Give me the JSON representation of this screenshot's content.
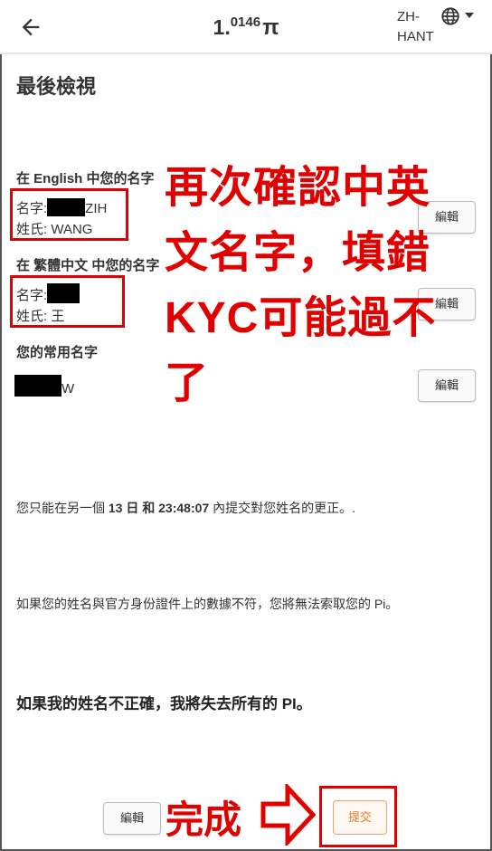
{
  "header": {
    "balance_int": "1.",
    "balance_frac": "0146",
    "currency_symbol": "π",
    "language": "ZH-HANT"
  },
  "page_title": "最後檢視",
  "english_section": {
    "label": "在 English 中您的名字",
    "first_name_label": "名字:",
    "first_name_visible": "ZIH",
    "last_name_label": "姓氏:",
    "last_name_value": "WANG",
    "edit_label": "編輯"
  },
  "chinese_section": {
    "label": "在 繁體中文 中您的名字",
    "first_name_label": "名字:",
    "last_name_label": "姓氏:",
    "last_name_value": "王",
    "edit_label": "編輯"
  },
  "common_section": {
    "label": "您的常用名字",
    "name_visible": "W",
    "edit_label": "編輯"
  },
  "overlay": {
    "lines": [
      "再次確認中英",
      "文名字，填錯",
      "KYC可能過不",
      "了"
    ],
    "done": "完成"
  },
  "notice": {
    "prefix": "您只能在另一個 ",
    "days": "13 日",
    "and": " 和 ",
    "time": "23:48:07",
    "suffix": " 內提交對您姓名的更正。."
  },
  "mismatch_notice": "如果您的姓名與官方身份證件上的數據不符，您將無法索取您的 Pi。",
  "warning": "如果我的姓名不正確，我將失去所有的 PI。",
  "footer": {
    "edit_label": "編輯",
    "submit_label": "提交"
  },
  "colors": {
    "annotation_red": "#e00000",
    "submit_orange": "#e87a2c"
  }
}
